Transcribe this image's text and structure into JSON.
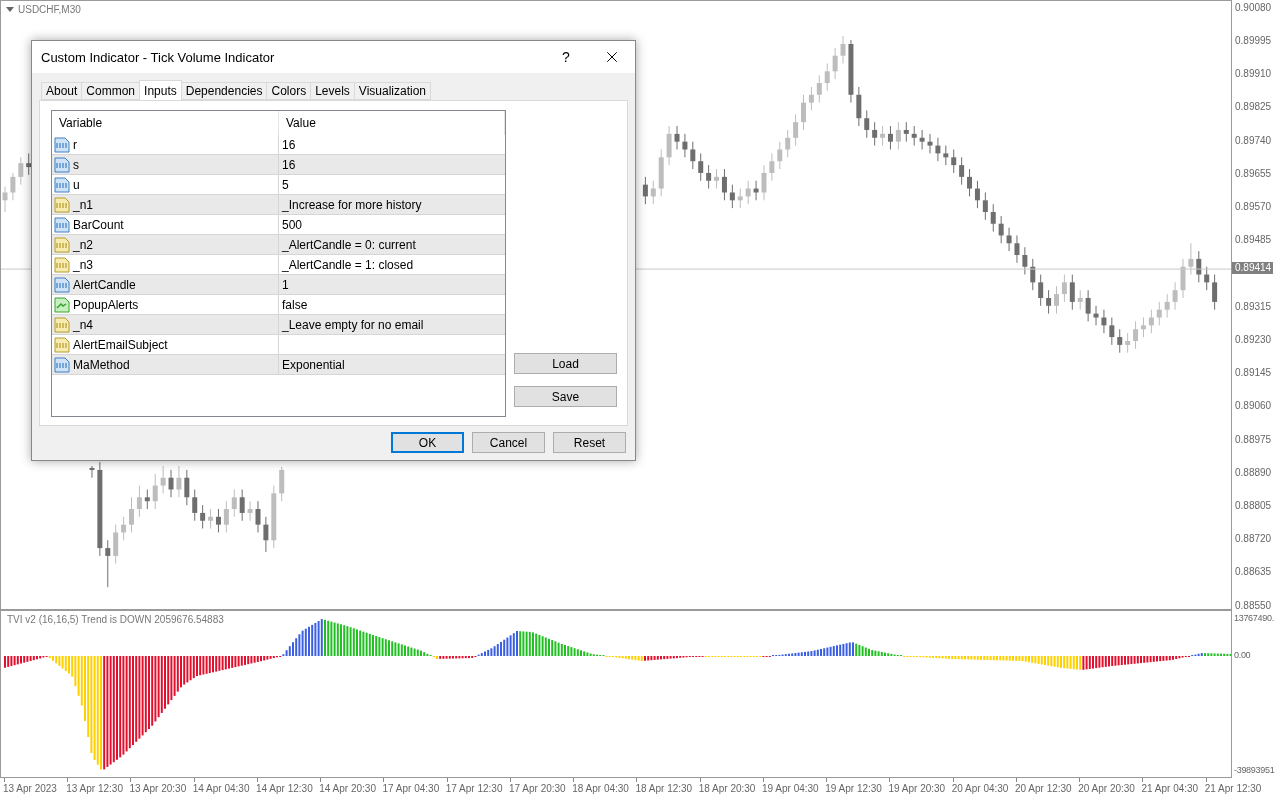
{
  "chart": {
    "symbol": "USDCHF,M30",
    "chart_data": {
      "type": "candlestick",
      "ohlc": [
        [
          0.8959,
          0.89625,
          0.8956,
          0.8961
        ],
        [
          0.8961,
          0.8966,
          0.8959,
          0.8965
        ],
        [
          0.8965,
          0.897,
          0.8963,
          0.89685
        ],
        [
          0.89685,
          0.8971,
          0.89655,
          0.89675
        ],
        null,
        null,
        null,
        null,
        null,
        null,
        null,
        [
          0.88905,
          0.8891,
          0.8888,
          0.889
        ],
        [
          0.889,
          0.8892,
          0.8868,
          0.887
        ],
        [
          0.887,
          0.8872,
          0.886,
          0.8868
        ],
        [
          0.8868,
          0.8876,
          0.8866,
          0.8874
        ],
        [
          0.8874,
          0.8878,
          0.8872,
          0.8876
        ],
        [
          0.8876,
          0.8883,
          0.8874,
          0.888
        ],
        [
          0.888,
          0.8886,
          0.8878,
          0.8883
        ],
        [
          0.8883,
          0.8885,
          0.888,
          0.8882
        ],
        [
          0.8882,
          0.8889,
          0.888,
          0.8886
        ],
        [
          0.8886,
          0.8891,
          0.8884,
          0.8888
        ],
        [
          0.8888,
          0.889,
          0.8883,
          0.8885
        ],
        [
          0.8885,
          0.8891,
          0.8883,
          0.8888
        ],
        [
          0.8888,
          0.889,
          0.8881,
          0.8883
        ],
        [
          0.8883,
          0.8885,
          0.8877,
          0.8879
        ],
        [
          0.8879,
          0.8881,
          0.8875,
          0.8877
        ],
        [
          0.8877,
          0.888,
          0.8875,
          0.8878
        ],
        [
          0.8878,
          0.888,
          0.8874,
          0.8876
        ],
        [
          0.8876,
          0.8882,
          0.8874,
          0.888
        ],
        [
          0.888,
          0.8885,
          0.8878,
          0.8883
        ],
        [
          0.8883,
          0.8885,
          0.8877,
          0.8879
        ],
        [
          0.8879,
          0.8882,
          0.8877,
          0.888
        ],
        [
          0.888,
          0.8882,
          0.8874,
          0.8876
        ],
        [
          0.8876,
          0.8878,
          0.8869,
          0.8872
        ],
        [
          0.8872,
          0.8886,
          0.887,
          0.8884
        ],
        [
          0.8884,
          0.88908,
          0.8882,
          0.889
        ],
        null,
        null,
        null,
        null,
        null,
        null,
        null,
        null,
        null,
        null,
        null,
        null,
        null,
        null,
        null,
        null,
        null,
        null,
        null,
        null,
        null,
        null,
        null,
        null,
        null,
        null,
        null,
        null,
        null,
        null,
        null,
        null,
        null,
        null,
        null,
        null,
        null,
        null,
        null,
        null,
        null,
        null,
        null,
        null,
        null,
        [
          0.8963,
          0.8965,
          0.8958,
          0.896
        ],
        [
          0.896,
          0.8964,
          0.8958,
          0.8962
        ],
        [
          0.8962,
          0.8972,
          0.896,
          0.897
        ],
        [
          0.897,
          0.8978,
          0.8968,
          0.8976
        ],
        [
          0.8976,
          0.8978,
          0.8972,
          0.8974
        ],
        [
          0.8974,
          0.8976,
          0.897,
          0.8972
        ],
        [
          0.8972,
          0.8974,
          0.8967,
          0.8969
        ],
        [
          0.8969,
          0.8971,
          0.8964,
          0.8966
        ],
        [
          0.8966,
          0.8968,
          0.8962,
          0.8964
        ],
        [
          0.8964,
          0.8967,
          0.8962,
          0.8965
        ],
        [
          0.8965,
          0.8967,
          0.8959,
          0.8961
        ],
        [
          0.8961,
          0.8963,
          0.8957,
          0.8959
        ],
        [
          0.8959,
          0.8962,
          0.8957,
          0.896
        ],
        [
          0.896,
          0.8964,
          0.8958,
          0.8962
        ],
        [
          0.8962,
          0.8964,
          0.8959,
          0.8961
        ],
        [
          0.8961,
          0.8968,
          0.8959,
          0.8966
        ],
        [
          0.8966,
          0.8971,
          0.8964,
          0.8969
        ],
        [
          0.8969,
          0.8974,
          0.8967,
          0.8972
        ],
        [
          0.8972,
          0.8977,
          0.897,
          0.8975
        ],
        [
          0.8975,
          0.8981,
          0.8973,
          0.8979
        ],
        [
          0.8979,
          0.8986,
          0.8977,
          0.8984
        ],
        [
          0.8984,
          0.8988,
          0.8982,
          0.8986
        ],
        [
          0.8986,
          0.8991,
          0.8984,
          0.8989
        ],
        [
          0.8989,
          0.8994,
          0.8987,
          0.8992
        ],
        [
          0.8992,
          0.8998,
          0.899,
          0.8996
        ],
        [
          0.8996,
          0.9001,
          0.8994,
          0.8999
        ],
        [
          0.8999,
          0.9,
          0.8984,
          0.8986
        ],
        [
          0.8986,
          0.8988,
          0.8978,
          0.898
        ],
        [
          0.898,
          0.8982,
          0.8975,
          0.8977
        ],
        [
          0.8977,
          0.8979,
          0.8973,
          0.8975
        ],
        [
          0.8975,
          0.8978,
          0.8973,
          0.8976
        ],
        [
          0.8976,
          0.8978,
          0.8972,
          0.8974
        ],
        [
          0.8974,
          0.8979,
          0.8972,
          0.8977
        ],
        [
          0.8977,
          0.8979,
          0.8974,
          0.8976
        ],
        [
          0.8976,
          0.8978,
          0.8973,
          0.8975
        ],
        [
          0.8975,
          0.8977,
          0.8972,
          0.8974
        ],
        [
          0.8974,
          0.8976,
          0.8971,
          0.8973
        ],
        [
          0.8973,
          0.8975,
          0.8969,
          0.8971
        ],
        [
          0.8971,
          0.8973,
          0.8968,
          0.897
        ],
        [
          0.897,
          0.8972,
          0.8966,
          0.8968
        ],
        [
          0.8968,
          0.897,
          0.8963,
          0.8965
        ],
        [
          0.8965,
          0.8967,
          0.896,
          0.8962
        ],
        [
          0.8962,
          0.8964,
          0.8957,
          0.8959
        ],
        [
          0.8959,
          0.8961,
          0.8954,
          0.8956
        ],
        [
          0.8956,
          0.8958,
          0.8951,
          0.8953
        ],
        [
          0.8953,
          0.8955,
          0.8948,
          0.895
        ],
        [
          0.895,
          0.8952,
          0.8946,
          0.8948
        ],
        [
          0.8948,
          0.895,
          0.8943,
          0.8945
        ],
        [
          0.8945,
          0.8947,
          0.894,
          0.8942
        ],
        [
          0.8942,
          0.8944,
          0.8936,
          0.8938
        ],
        [
          0.8938,
          0.894,
          0.8932,
          0.8934
        ],
        [
          0.8934,
          0.8936,
          0.893,
          0.8932
        ],
        [
          0.8932,
          0.8937,
          0.893,
          0.8935
        ],
        [
          0.8935,
          0.894,
          0.8933,
          0.8938
        ],
        [
          0.8938,
          0.894,
          0.8931,
          0.8933
        ],
        [
          0.8933,
          0.8936,
          0.8931,
          0.8934
        ],
        [
          0.8934,
          0.8936,
          0.8928,
          0.893
        ],
        [
          0.893,
          0.8932,
          0.8927,
          0.8929
        ],
        [
          0.8929,
          0.8931,
          0.8925,
          0.8927
        ],
        [
          0.8927,
          0.8929,
          0.8922,
          0.8924
        ],
        [
          0.8924,
          0.8926,
          0.892,
          0.8922
        ],
        [
          0.8922,
          0.8925,
          0.892,
          0.8923
        ],
        [
          0.8923,
          0.8928,
          0.8921,
          0.8926
        ],
        [
          0.8926,
          0.8929,
          0.8924,
          0.8927
        ],
        [
          0.8927,
          0.8931,
          0.8925,
          0.8929
        ],
        [
          0.8929,
          0.8933,
          0.8927,
          0.8931
        ],
        [
          0.8931,
          0.8935,
          0.8929,
          0.8933
        ],
        [
          0.8933,
          0.8938,
          0.8931,
          0.8936
        ],
        [
          0.8936,
          0.8944,
          0.8934,
          0.8942
        ],
        [
          0.8942,
          0.8948,
          0.894,
          0.8944
        ],
        [
          0.8944,
          0.8946,
          0.8938,
          0.894
        ],
        [
          0.894,
          0.8942,
          0.8936,
          0.8938
        ],
        [
          0.8938,
          0.894,
          0.8931,
          0.8933
        ]
      ],
      "yticks": [
        {
          "value": 0.9008,
          "label": "0.90080"
        },
        {
          "value": 0.89995,
          "label": "0.89995"
        },
        {
          "value": 0.8991,
          "label": "0.89910"
        },
        {
          "value": 0.89825,
          "label": "0.89825"
        },
        {
          "value": 0.8974,
          "label": "0.89740"
        },
        {
          "value": 0.89655,
          "label": "0.89655"
        },
        {
          "value": 0.8957,
          "label": "0.89570"
        },
        {
          "value": 0.89485,
          "label": "0.89485"
        },
        {
          "value": 0.89315,
          "label": "0.89315"
        },
        {
          "value": 0.8923,
          "label": "0.89230"
        },
        {
          "value": 0.89145,
          "label": "0.89145"
        },
        {
          "value": 0.8906,
          "label": "0.89060"
        },
        {
          "value": 0.88975,
          "label": "0.88975"
        },
        {
          "value": 0.8889,
          "label": "0.88890"
        },
        {
          "value": 0.88805,
          "label": "0.88805"
        },
        {
          "value": 0.8872,
          "label": "0.88720"
        },
        {
          "value": 0.88635,
          "label": "0.88635"
        },
        {
          "value": 0.8855,
          "label": "0.88550"
        }
      ],
      "ylim": [
        0.88539,
        0.901
      ],
      "ref_lines": [
        {
          "axis": "y",
          "value": 0.89414,
          "label": "0.89414"
        }
      ]
    }
  },
  "time_labels": [
    "13 Apr 2023",
    "13 Apr 12:30",
    "13 Apr 20:30",
    "14 Apr 04:30",
    "14 Apr 12:30",
    "14 Apr 20:30",
    "17 Apr 04:30",
    "17 Apr 12:30",
    "17 Apr 20:30",
    "18 Apr 04:30",
    "18 Apr 12:30",
    "18 Apr 20:30",
    "19 Apr 04:30",
    "19 Apr 12:30",
    "19 Apr 20:30",
    "20 Apr 04:30",
    "20 Apr 12:30",
    "20 Apr 20:30",
    "21 Apr 04:30",
    "21 Apr 12:30"
  ],
  "indicator": {
    "label": "TVI v2 (16,16,5) Trend is DOWN 2059676.54883",
    "axis_labels": [
      "13767490.",
      "0.00",
      "-39893951"
    ]
  },
  "dialog": {
    "title": "Custom Indicator - Tick Volume Indicator",
    "help": "?",
    "tabs": [
      {
        "label": "About",
        "selected": false
      },
      {
        "label": "Common",
        "selected": false
      },
      {
        "label": "Inputs",
        "selected": true
      },
      {
        "label": "Dependencies",
        "selected": false
      },
      {
        "label": "Colors",
        "selected": false
      },
      {
        "label": "Levels",
        "selected": false
      },
      {
        "label": "Visualization",
        "selected": false
      }
    ],
    "columns": [
      "Variable",
      "Value"
    ],
    "rows": [
      {
        "kind": "number",
        "variable": "r",
        "value": "16"
      },
      {
        "kind": "number",
        "variable": "s",
        "value": "16"
      },
      {
        "kind": "number",
        "variable": "u",
        "value": "5"
      },
      {
        "kind": "text",
        "variable": "_n1",
        "value": "_Increase for more history"
      },
      {
        "kind": "number",
        "variable": "BarCount",
        "value": "500"
      },
      {
        "kind": "text",
        "variable": "_n2",
        "value": "_AlertCandle = 0: current"
      },
      {
        "kind": "text",
        "variable": "_n3",
        "value": "_AlertCandle = 1: closed"
      },
      {
        "kind": "number",
        "variable": "AlertCandle",
        "value": "1"
      },
      {
        "kind": "bool",
        "variable": "PopupAlerts",
        "value": "false"
      },
      {
        "kind": "text",
        "variable": "_n4",
        "value": "_Leave empty for no email"
      },
      {
        "kind": "text",
        "variable": "AlertEmailSubject"
      },
      {
        "kind": "number",
        "variable": "MaMethod",
        "value": "Exponential"
      }
    ],
    "side_buttons": [
      "Load",
      "Save"
    ],
    "buttons": [
      {
        "label": "OK",
        "default": true
      },
      {
        "label": "Cancel",
        "default": false
      },
      {
        "label": "Reset",
        "default": false
      }
    ]
  }
}
